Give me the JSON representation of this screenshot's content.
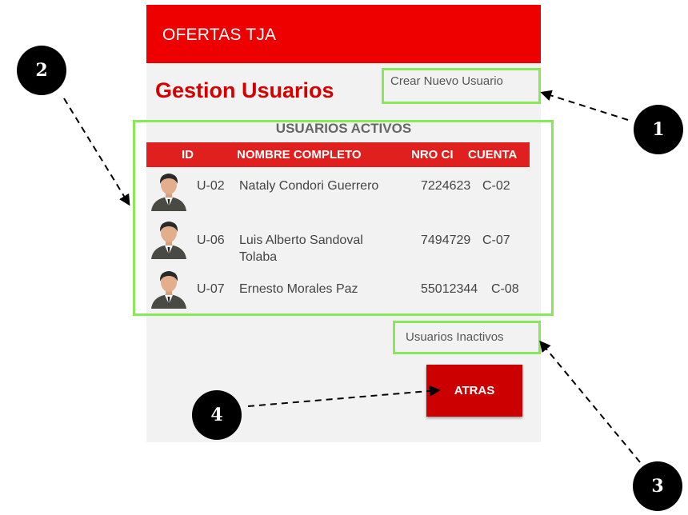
{
  "app": {
    "title": "OFERTAS TJA"
  },
  "page": {
    "title": "Gestion Usuarios",
    "create_user_link": "Crear Nuevo Usuario",
    "section_title": "USUARIOS ACTIVOS",
    "inactive_users_link": "Usuarios Inactivos",
    "back_button": "ATRAS"
  },
  "table": {
    "columns": [
      "ID",
      "NOMBRE COMPLETO",
      "NRO CI",
      "CUENTA"
    ],
    "rows": [
      {
        "id": "U-02",
        "name": "Nataly Condori Guerrero",
        "ci": "7224623",
        "account": "C-02"
      },
      {
        "id": "U-06",
        "name": "Luis Alberto  Sandoval Tolaba",
        "ci": "7494729",
        "account": "C-07"
      },
      {
        "id": "U-07",
        "name": "Ernesto  Morales Paz",
        "ci": "55012344",
        "account": "C-08"
      }
    ]
  },
  "annotations": {
    "badges": [
      "1",
      "2",
      "3",
      "4"
    ]
  },
  "colors": {
    "appbar": "#ee0000",
    "title": "#d40000",
    "header_row": "#e0201e",
    "button": "#cc0000",
    "callout_border": "#88e858",
    "badge": "#000000"
  },
  "icons": {
    "avatar": "user-avatar-icon"
  }
}
